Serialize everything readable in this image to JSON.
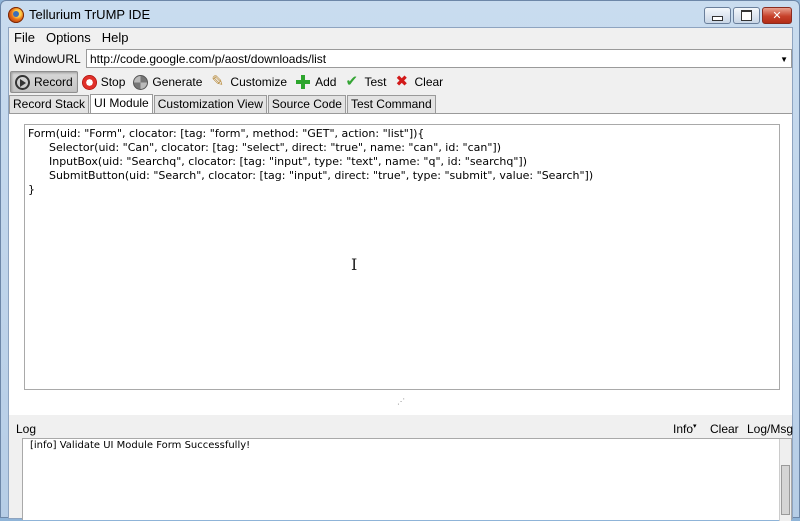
{
  "window": {
    "title": "Tellurium TrUMP IDE"
  },
  "menu": {
    "items": [
      "File",
      "Options",
      "Help"
    ]
  },
  "url_bar": {
    "label": "WindowURL",
    "value": "http://code.google.com/p/aost/downloads/list"
  },
  "toolbar": {
    "record": "Record",
    "stop": "Stop",
    "generate": "Generate",
    "customize": "Customize",
    "add": "Add",
    "test": "Test",
    "clear": "Clear"
  },
  "tabs": [
    "Record Stack",
    "UI Module",
    "Customization View",
    "Source Code",
    "Test Command"
  ],
  "active_tab": "UI Module",
  "editor": {
    "content": "Form(uid: \"Form\", clocator: [tag: \"form\", method: \"GET\", action: \"list\"]){\n      Selector(uid: \"Can\", clocator: [tag: \"select\", direct: \"true\", name: \"can\", id: \"can\"])\n      InputBox(uid: \"Searchq\", clocator: [tag: \"input\", type: \"text\", name: \"q\", id: \"searchq\"])\n      SubmitButton(uid: \"Search\", clocator: [tag: \"input\", direct: \"true\", type: \"submit\", value: \"Search\"])\n}"
  },
  "log": {
    "title": "Log",
    "info_label": "Info",
    "clear_label": "Clear",
    "toggle_label": "Log/Msg",
    "message": "[info] Validate UI Module Form Successfully!"
  }
}
